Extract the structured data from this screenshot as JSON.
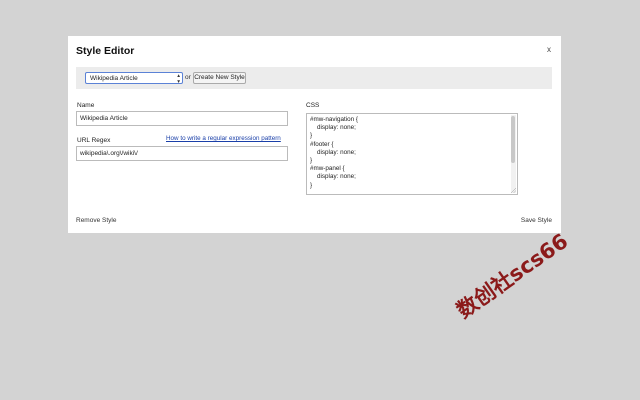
{
  "dialog": {
    "title": "Style Editor",
    "close_label": "x"
  },
  "toolbar": {
    "selected_style": "Wikipedia Article",
    "or_text": "or",
    "new_style_label": "Create New Style"
  },
  "form": {
    "name_label": "Name",
    "name_value": "Wikipedia Article",
    "url_label": "URL Regex",
    "url_value": "wikipedia\\.org\\/wiki\\/",
    "help_link": "How to write a regular expression pattern",
    "css_label": "CSS",
    "css_value": "#mw-navigation {\n    display: none;\n}\n#footer {\n    display: none;\n}\n#mw-panel {\n    display: none;\n}"
  },
  "footer": {
    "remove_label": "Remove Style",
    "save_label": "Save Style"
  },
  "watermark": {
    "text": "数创社scs66"
  },
  "colors": {
    "background": "#d3d3d3",
    "dialog": "#ffffff",
    "toolbar": "#ececec",
    "link": "#1a3fa8",
    "watermark": "#8b1a1a"
  }
}
